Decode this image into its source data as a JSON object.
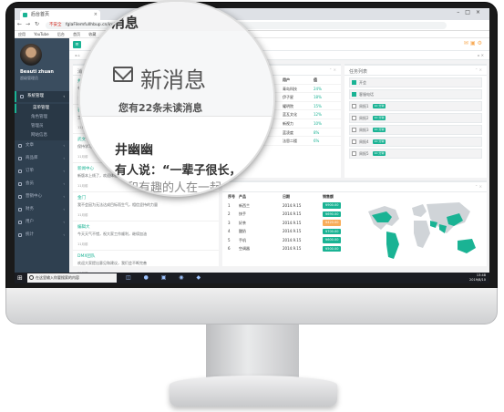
{
  "browser": {
    "tab_title": "后台首页",
    "url_warning": "不安全",
    "url": "fglaFilemfullhbup.cn/index",
    "bookmarks": [
      "应用",
      "YouTube",
      "后台",
      "首页",
      "收藏"
    ]
  },
  "sidebar": {
    "user_name": "Beauti zhuan",
    "user_role": "超级管理员",
    "items": [
      {
        "label": "系统管理",
        "active": true
      },
      {
        "label": "菜单管理",
        "sub": true,
        "active": true
      },
      {
        "label": "角色管理",
        "sub": true
      },
      {
        "label": "管理员",
        "sub": true
      },
      {
        "label": "网站信息",
        "sub": true
      },
      {
        "label": "文章"
      },
      {
        "label": "商品库"
      },
      {
        "label": "订单"
      },
      {
        "label": "会员"
      },
      {
        "label": "营销中心"
      },
      {
        "label": "财务"
      },
      {
        "label": "用户"
      },
      {
        "label": "统计"
      }
    ]
  },
  "topbar": {
    "menu_icon": "hamburger-icon"
  },
  "messages": {
    "title": "消息",
    "items": [
      {
        "title": "井幽幽",
        "desc": "有人说：一辈子很长，要和有趣的人在一起...",
        "time": "11月前"
      },
      {
        "title": "石竹",
        "desc": "工作之余要懂得生活...",
        "time": "11月前"
      },
      {
        "title": "武文",
        "desc": "保持学习的热情，不断成长",
        "time": "11月前"
      },
      {
        "title": "新闻中心",
        "desc": "新版本上线了，欢迎体验",
        "time": "11月前"
      },
      {
        "title": "金门",
        "desc": "我不会因为无法达成目标而生气，相信坚持的力量",
        "time": "11月前"
      },
      {
        "title": "编辑大",
        "desc": "今天天气不错，祝大家工作顺利，继续加油",
        "time": "11月前"
      },
      {
        "title": "DMX团队",
        "desc": "欢迎大家提出意见和建议，我们会不断完善",
        "time": "11月前"
      }
    ]
  },
  "projects": {
    "title": "项目",
    "header": [
      "用户",
      "值"
    ],
    "rows": [
      {
        "name": "青岛科技",
        "value": "24%"
      },
      {
        "name": "伊子星",
        "value": "18%"
      },
      {
        "name": "耀明院",
        "value": "15%"
      },
      {
        "name": "蓝瓦文化",
        "value": "12%"
      },
      {
        "name": "新视力",
        "value": "10%"
      },
      {
        "name": "蓝凌度",
        "value": "8%"
      },
      {
        "name": "法思二楼",
        "value": "6%"
      }
    ]
  },
  "tasks": {
    "title": "任务列表",
    "items": [
      {
        "label": "开会",
        "checked": true,
        "tag": ""
      },
      {
        "label": "客服电话",
        "checked": true,
        "tag": ""
      },
      {
        "label": "周报1",
        "checked": false,
        "tag": "10 分钟"
      },
      {
        "label": "周报2",
        "checked": false,
        "tag": "10 分钟"
      },
      {
        "label": "周报3",
        "checked": false,
        "tag": "10 分钟"
      },
      {
        "label": "周报4",
        "checked": false,
        "tag": "10 分钟"
      },
      {
        "label": "周报5",
        "checked": false,
        "tag": "10 分钟"
      }
    ]
  },
  "sales": {
    "header": [
      "序号",
      "产品",
      "日期",
      "销售额"
    ],
    "rows": [
      {
        "n": "1",
        "product": "新西兰",
        "date": "2014.9.15",
        "amount": "¥900.00",
        "color": "#1ab394"
      },
      {
        "n": "2",
        "product": "快手",
        "date": "2014.9.15",
        "amount": "¥690.00",
        "color": "#1ab394"
      },
      {
        "n": "3",
        "product": "好茶",
        "date": "2014.9.15",
        "amount": "¥420.00",
        "color": "#f8ac59"
      },
      {
        "n": "4",
        "product": "酸奶",
        "date": "2014.9.15",
        "amount": "¥700.00",
        "color": "#1ab394"
      },
      {
        "n": "5",
        "product": "手机",
        "date": "2014.9.15",
        "amount": "¥600.00",
        "color": "#1ab394"
      },
      {
        "n": "6",
        "product": "空调器",
        "date": "2014.9.15",
        "amount": "¥500.00",
        "color": "#1ab394"
      }
    ]
  },
  "magnifier": {
    "header_title": "消息",
    "title": "新消息",
    "subtitle": "您有22条未读消息",
    "sender": "井幽幽",
    "quote": "有人说：“一辈子很长，",
    "quote_tail": "要和有趣的人在一起"
  },
  "taskbar": {
    "search_placeholder": "在这里输入你要搜索的内容",
    "time": "13:48",
    "date": "2019/8/10"
  },
  "colors": {
    "accent": "#1ab394",
    "sidebar": "#2f4050",
    "warning": "#f8ac59"
  }
}
